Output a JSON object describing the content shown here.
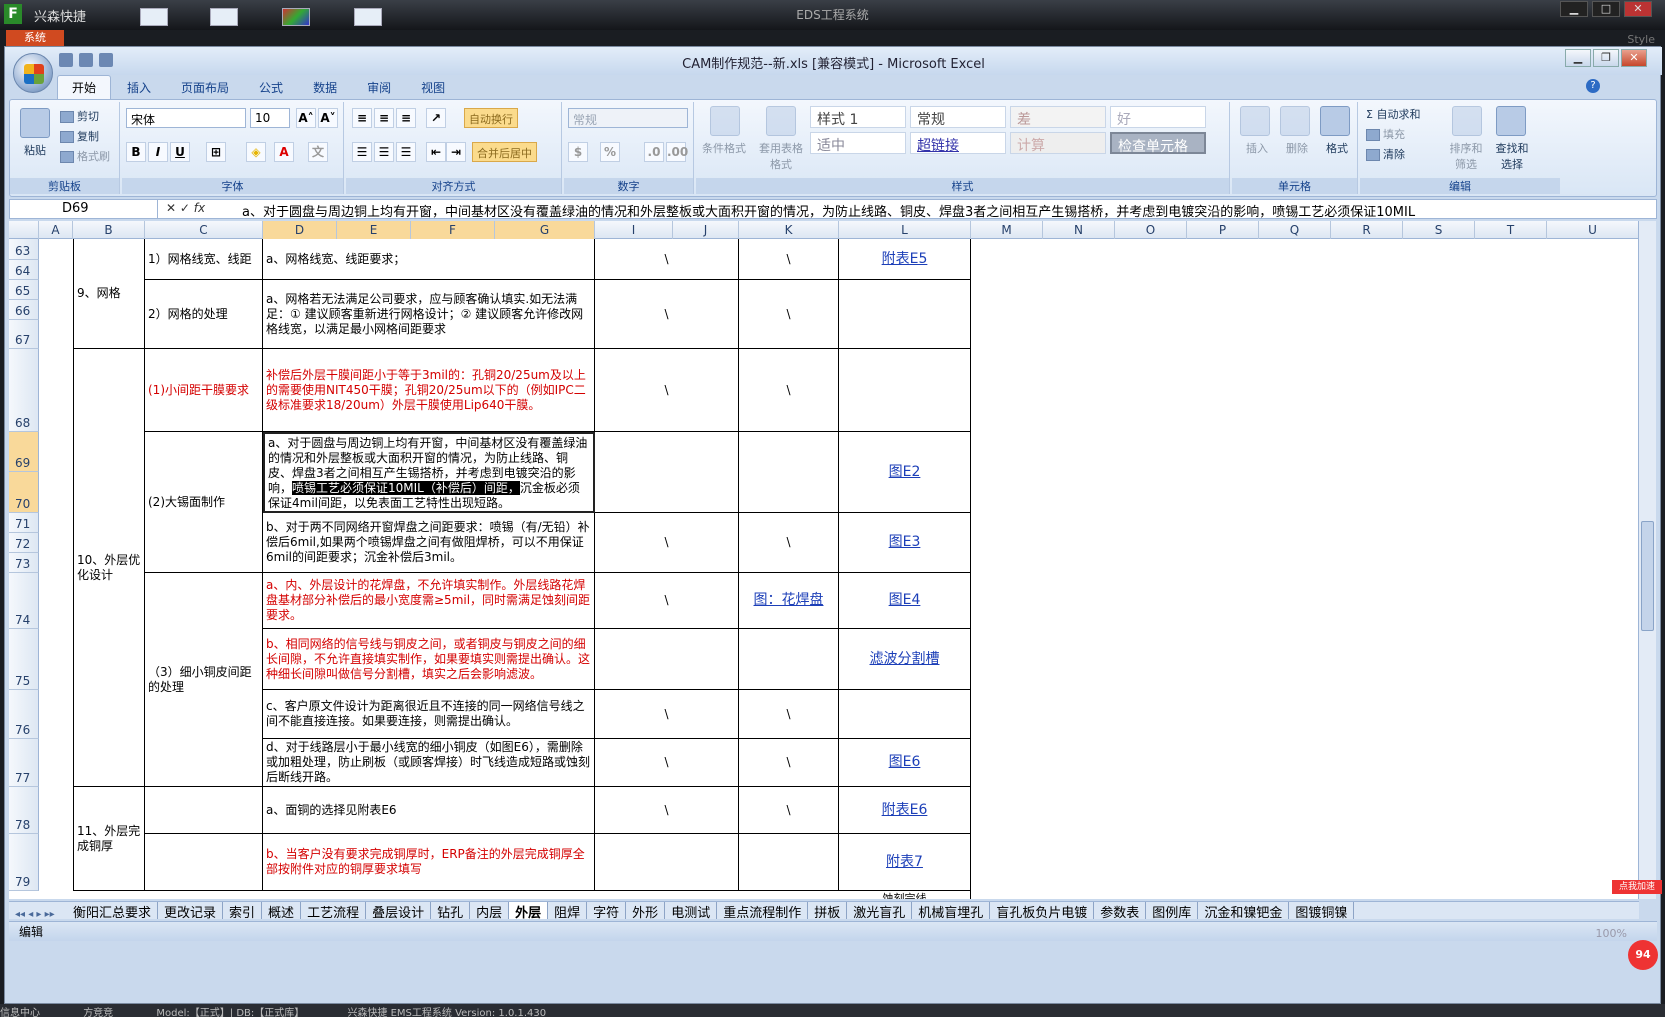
{
  "eds": {
    "app_name": "兴森快捷",
    "title": "EDS工程系统",
    "system_tab": "系统",
    "style_label": "Style",
    "min": "▁",
    "max": "□",
    "close": "✕"
  },
  "excel": {
    "doc_title": "CAM制作规范--新.xls [兼容模式] - Microsoft Excel",
    "tabs": [
      "开始",
      "插入",
      "页面布局",
      "公式",
      "数据",
      "审阅",
      "视图"
    ],
    "ribbon": {
      "clipboard": {
        "label": "剪贴板",
        "paste": "粘贴",
        "cut": "剪切",
        "copy": "复制",
        "format_painter": "格式刷"
      },
      "font": {
        "label": "字体",
        "font_name": "宋体",
        "font_size": "10",
        "bold": "B",
        "italic": "I",
        "underline": "U",
        "grow": "A˄",
        "shrink": "A˅"
      },
      "alignment": {
        "label": "对齐方式",
        "wrap": "自动换行",
        "merge": "合并后居中"
      },
      "number": {
        "label": "数字",
        "format": "常规",
        "percent": "%"
      },
      "styles": {
        "label": "样式",
        "cond_format": "条件格式",
        "table_format": "套用表格格式",
        "cells": [
          "样式 1",
          "常规",
          "差",
          "好",
          "适中",
          "超链接",
          "计算",
          "检查单元格"
        ]
      },
      "cells": {
        "label": "单元格",
        "insert": "插入",
        "delete": "删除",
        "format": "格式"
      },
      "editing": {
        "label": "编辑",
        "autosum": "自动求和",
        "fill": "填充",
        "clear": "清除",
        "sort": "排序和筛选",
        "find": "查找和选择"
      }
    },
    "name_box": "D69",
    "formula": "a、对于圆盘与周边铜上均有开窗，中间基材区没有覆盖绿油的情况和外层整板或大面积开窗的情况，为防止线路、铜皮、焊盘3者之间相互产生锡搭桥，并考虑到电镀突沿的影响，喷锡工艺必须保证10MIL",
    "columns": [
      "A",
      "B",
      "C",
      "D",
      "E",
      "F",
      "G",
      "I",
      "J",
      "K",
      "L",
      "M",
      "N",
      "O",
      "P",
      "Q",
      "R",
      "S",
      "T",
      "U"
    ],
    "rows": [
      "63",
      "64",
      "65",
      "66",
      "67",
      "68",
      "69",
      "70",
      "71",
      "72",
      "73",
      "74",
      "75",
      "76",
      "77",
      "78",
      "79"
    ],
    "cells": {
      "b_9": "9、网格",
      "c_63": "1）网格线宽、线距",
      "d_63": "a、网格线宽、线距要求；",
      "i_63": "\\",
      "k_63": "\\",
      "l_63": "附表E5",
      "c_65": "2）网格的处理",
      "d_65": "a、网格若无法满足公司要求，应与顾客确认填实.如无法满足：① 建议顾客重新进行网格设计；② 建议顾客允许修改网格线宽，以满足最小网格间距要求",
      "i_65": "\\",
      "k_65": "\\",
      "c_68": "(1)小间距干膜要求",
      "d_68": "补偿后外层干膜间距小于等于3mil的：孔铜20/25um及以上的需要使用NIT450干膜；孔铜20/25um以下的（例如IPC二级标准要求18/20um）外层干膜使用Lip640干膜。",
      "i_68": "\\",
      "k_68": "\\",
      "b_10": "10、外层优化设计",
      "c_69": "(2)大锡面制作",
      "d_69_a": "a、对于圆盘与周边铜上均有开窗，中间基材区没有覆盖绿油的情况和外层整板或大面积开窗的情况，为防止线路、铜皮、焊盘3者之间相互产生锡搭桥，并考虑到电镀突沿的影响，",
      "d_69_b": "喷锡工艺必须保证10MIL（补偿后）间距，",
      "d_69_c": "沉金板必须保证4mil间距，以免表面工艺特性出现短路。",
      "l_69": "图E2",
      "d_71": "b、对于两不同网络开窗焊盘之间距要求：喷锡（有/无铅）补偿后6mil,如果两个喷锡焊盘之间有做阻焊桥，可以不用保证6mil的间距要求；沉金补偿后3mil。",
      "i_71": "\\",
      "k_71": "\\",
      "l_71": "图E3",
      "c_74": "（3）细小铜皮间距的处理",
      "d_74": "a、内、外层设计的花焊盘，不允许填实制作。外层线路花焊盘基材部分补偿后的最小宽度需≥5mil，同时需满足蚀刻间距要求。",
      "i_74": "\\",
      "k_74": "图：花焊盘",
      "l_74": "图E4",
      "d_75": "b、相同网络的信号线与铜皮之间，或者铜皮与铜皮之间的细长间隙，不允许直接填实制作，如果要填实则需提出确认。这种细长间隙叫做信号分割槽，填实之后会影响滤波。",
      "l_75": "滤波分割槽",
      "d_76": "c、客户原文件设计为距离很近且不连接的同一网络信号线之间不能直接连接。如果要连接，则需提出确认。",
      "i_76": "\\",
      "k_76": "\\",
      "d_77": "d、对于线路层小于最小线宽的细小铜皮（如图E6），需删除或加粗处理，防止刷板（或顾客焊接）时飞线造成短路或蚀刻后断线开路。",
      "i_77": "\\",
      "k_77": "\\",
      "l_77": "图E6",
      "b_11": "11、外层完成铜厚",
      "d_78": "a、面铜的选择见附表E6",
      "i_78": "\\",
      "k_78": "\\",
      "l_78": "附表E6",
      "d_79": "b、当客户没有要求完成铜厚时，ERP备注的外层完成铜厚全部按附件对应的铜厚要求填写",
      "l_79": "附表7",
      "l_80": "蚀刻完线"
    },
    "sheet_tabs": [
      "衡阳汇总要求",
      "更改记录",
      "索引",
      "概述",
      "工艺流程",
      "叠层设计",
      "钻孔",
      "内层",
      "外层",
      "阻焊",
      "字符",
      "外形",
      "电测试",
      "重点流程制作",
      "拼板",
      "激光盲孔",
      "机械盲埋孔",
      "盲孔板负片电镀",
      "参数表",
      "图例库",
      "沉金和镍钯金",
      "图镀铜镍"
    ],
    "active_sheet": "外层",
    "sheet_nav": "◂◂ ◂ ▸ ▸▸",
    "status": "编辑",
    "zoom": "100%"
  },
  "bottom": {
    "info": "信息中心",
    "user": "方竞竞",
    "model": "Model:【正式】| DB:【正式库】",
    "version": "兴森快捷 EMS工程系统 Version: 1.0.1.430"
  },
  "promo": "点我加速",
  "badge": "94"
}
